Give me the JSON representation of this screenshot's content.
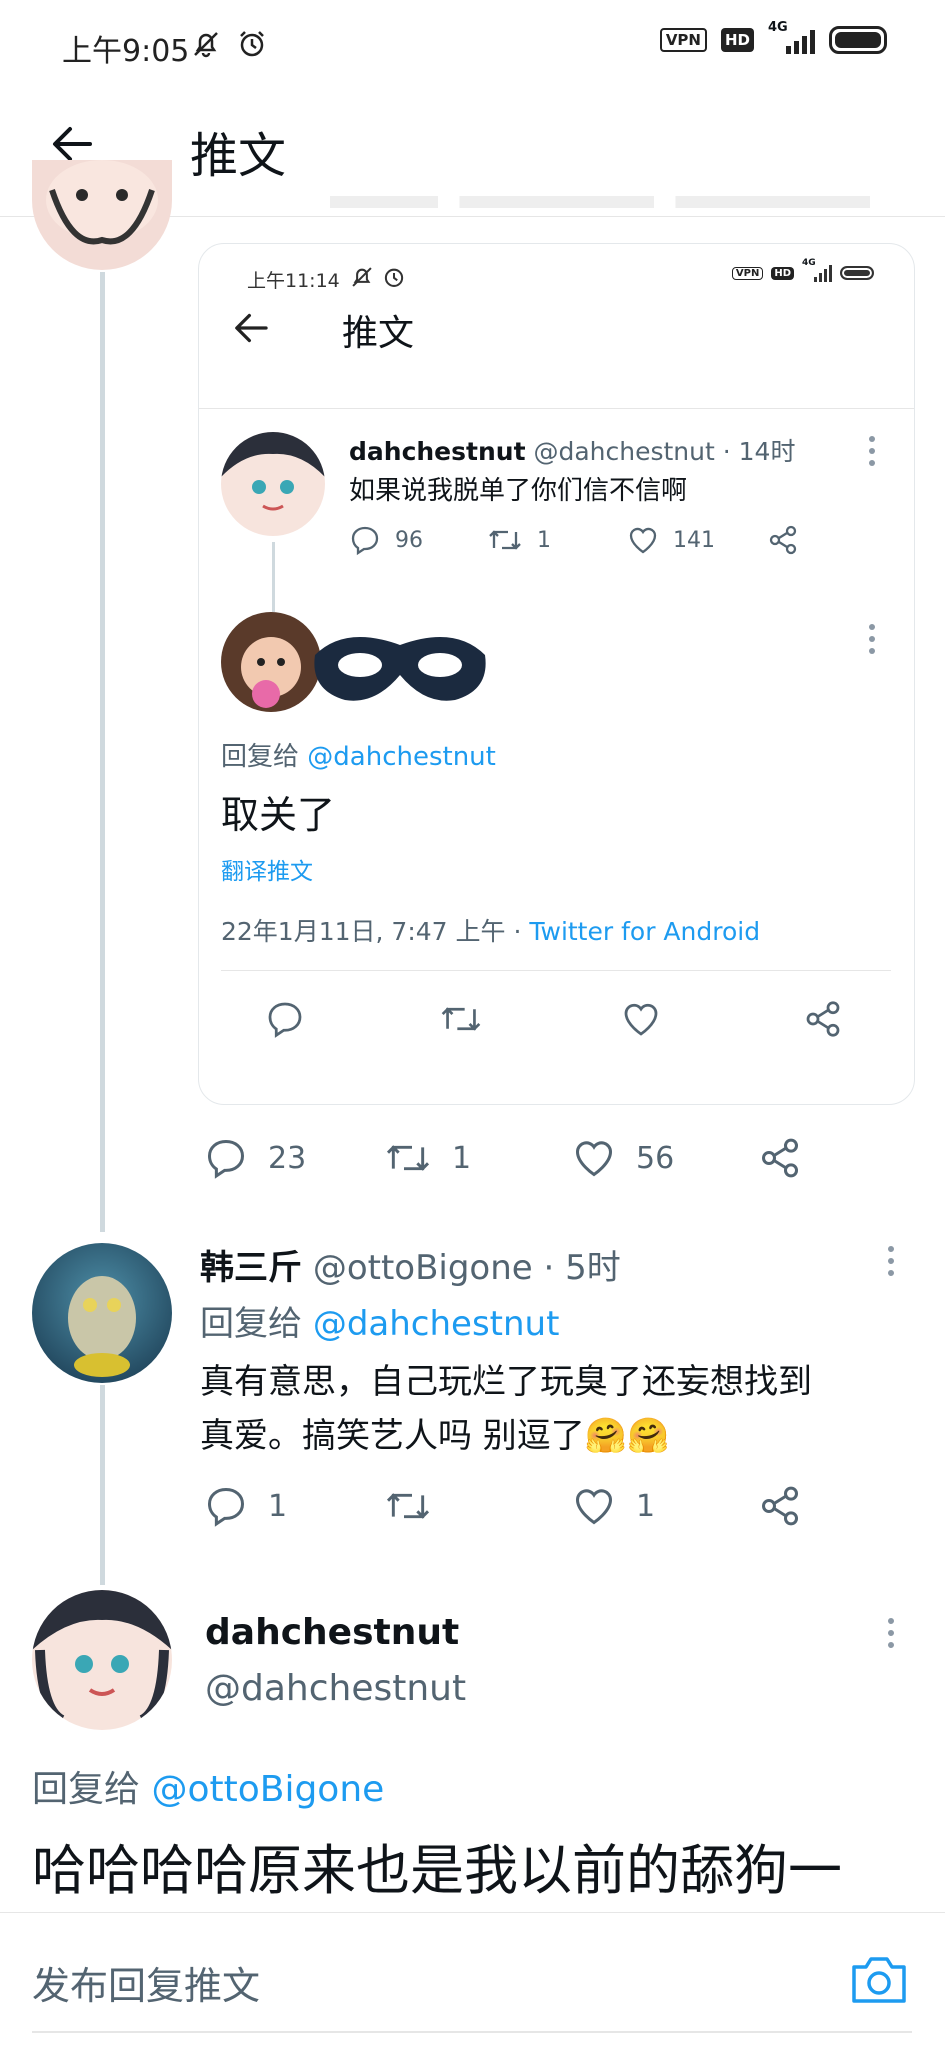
{
  "status_bar": {
    "time": "上午9:05",
    "vpn": "VPN",
    "hd": "HD",
    "network": "4G"
  },
  "header": {
    "title": "推文"
  },
  "embedded_screenshot": {
    "status_time": "上午11:14",
    "vpn": "VPN",
    "hd": "HD",
    "network": "4G",
    "header_title": "推文",
    "tweet": {
      "display_name": "dahchestnut",
      "handle_time": "@dahchestnut · 14时",
      "text": "如果说我脱单了你们信不信啊",
      "replies": "96",
      "retweets": "1",
      "likes": "141"
    },
    "reply": {
      "reply_to_prefix": "回复给",
      "reply_to_handle": "@dahchestnut",
      "text": "取关了",
      "translate": "翻译推文",
      "date": "22年1月11日, 7:47 上午 · ",
      "source": "Twitter for Android"
    }
  },
  "post1_actions": {
    "replies": "23",
    "retweets": "1",
    "likes": "56"
  },
  "post2": {
    "display_name": "韩三斤",
    "handle_time": "@ottoBigone · 5时",
    "reply_to_prefix": "回复给",
    "reply_to_handle": "@dahchestnut",
    "text_line1": "真有意思，自己玩烂了玩臭了还妄想找到",
    "text_line2": "真爱。搞笑艺人吗 别逗了🤗🤗",
    "replies": "1",
    "retweets": "",
    "likes": "1"
  },
  "post3": {
    "display_name": "dahchestnut",
    "handle": "@dahchestnut",
    "reply_to_prefix": "回复给",
    "reply_to_handle": "@ottoBigone",
    "text": "哈哈哈哈原来也是我以前的舔狗一"
  },
  "reply_bar": {
    "placeholder": "发布回复推文"
  },
  "colors": {
    "link": "#1d9bf0",
    "muted": "#536471",
    "thread_line": "#cfd9de"
  }
}
